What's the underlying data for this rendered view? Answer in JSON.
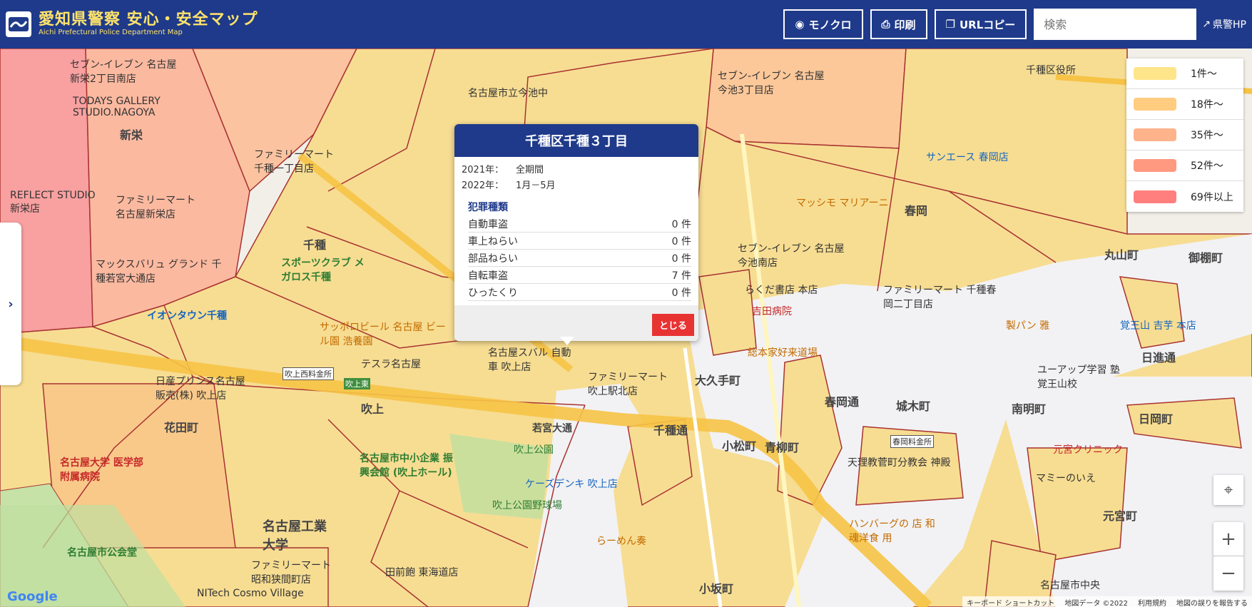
{
  "header": {
    "title": "愛知県警察 安心・安全マップ",
    "subtitle": "Aichi Prefectural Police Department Map",
    "buttons": {
      "mono": "モノクロ",
      "print": "印刷",
      "url_copy": "URLコピー"
    },
    "search_placeholder": "検索",
    "hp_link": "県警HP"
  },
  "legend": [
    {
      "label": "1件〜",
      "color": "#ffe58a"
    },
    {
      "label": "18件〜",
      "color": "#ffcc80"
    },
    {
      "label": "35件〜",
      "color": "#ffb38a"
    },
    {
      "label": "52件〜",
      "color": "#ff9980"
    },
    {
      "label": "69件以上",
      "color": "#ff7f7f"
    }
  ],
  "popup": {
    "title": "千種区千種３丁目",
    "period_2021_label": "2021年：",
    "period_2021_value": "全期間",
    "period_2022_label": "2022年：",
    "period_2022_value": "1月－5月",
    "crime_header": "犯罪種類",
    "crimes": [
      {
        "name": "自動車盗",
        "count": "0 件"
      },
      {
        "name": "車上ねらい",
        "count": "0 件"
      },
      {
        "name": "部品ねらい",
        "count": "0 件"
      },
      {
        "name": "自転車盗",
        "count": "7 件"
      },
      {
        "name": "ひったくり",
        "count": "0 件"
      }
    ],
    "close_label": "とじる"
  },
  "map_labels": {
    "shinsakae": "新栄",
    "chikusa": "千種",
    "fukiage": "吹上",
    "hanadacho": "花田町",
    "haruoka": "春岡",
    "ookute": "大久手町",
    "shirokicho": "城木町",
    "nanmeicho": "南明町",
    "chikusa_dori": "千種通",
    "komatsucho": "小松町",
    "aoyagicho": "青柳町",
    "haruoka_dori": "春岡通",
    "nisshin": "日進通",
    "maruyama": "丸山町",
    "gosho": "御棚町",
    "nittamachi": "日岡町",
    "motomiya": "元宮町",
    "kosaka": "小坂町",
    "nagoya_kodai": "名古屋工業大学",
    "seven_shinsakae": "セブン-イレブン 名古屋新栄2丁目南店",
    "todays_gallery": "TODAYS GALLERY STUDIO.NAGOYA",
    "reflect": "REFLECT STUDIO 新栄店",
    "family_shinsakae": "ファミリーマート 名古屋新栄店",
    "max_value": "マックスバリュ グランド 千種若宮大通店",
    "aeon": "イオンタウン千種",
    "sports_club": "スポーツクラブ メガロス千種",
    "sapporo": "サッポロビール 名古屋 ビール園 浩養園",
    "family_chikusa1": "ファミリーマート 千種一丁目店",
    "ikeshita_pond": "名古屋市立今池中",
    "seven_imaike3": "セブン-イレブン 名古屋今池3丁目店",
    "sun_ace": "サンエース 春岡店",
    "massimo": "マッシモ マリアーニ",
    "seven_imaikeminami": "セブン-イレブン 名古屋今池南店",
    "rakuda": "らくだ書店 本店",
    "yoshida": "吉田病院",
    "family_haruoka2": "ファミリーマート 千種春岡二丁目店",
    "chikusa_ward_office": "千種区役所",
    "subaru": "名古屋スバル 自動車 吹上店",
    "tesla": "テスラ名古屋",
    "family_fukiage": "ファミリーマート 吹上駅北店",
    "nissan_prince": "日産プリンス名古屋 販売(株) 吹上店",
    "fukiage_park": "吹上公園",
    "fukiage_hall": "名古屋市中小企業 振興会館 (吹上ホール)",
    "kesdenki": "ケーズデンキ 吹上店",
    "fukiage_ball": "吹上公園野球場",
    "nagoya_univ": "名古屋大学 医学部附属病院",
    "kokaido": "名古屋市公会堂",
    "family_showa": "ファミリーマート 昭和狭間町店",
    "denmae": "田前飽 東海道店",
    "nitech": "NITech Cosmo Village",
    "ramen": "らーめん奏",
    "hamburg": "ハンバーグの 店 和魂洋食 用",
    "tenri": "天理教菅町分教会 神殿",
    "sohonke": "総本家好来道場",
    "seipan": "製パン 雅",
    "kakuozan": "覚王山 吉芋 本店",
    "yuapp": "ユーアップ学習 塾 覚王山校",
    "motomiya_clinic": "元宮クリニック",
    "mamie": "マミーのいえ",
    "nagoya_chuo": "名古屋市中央",
    "toll_fukiage": "吹上西料金所",
    "toll_fukiage_e": "吹上東",
    "toll_haruoka": "春岡料金所",
    "wakamiya": "若宮大通"
  },
  "attribution": {
    "shortcuts": "キーボード ショートカット",
    "mapdata": "地図データ ©2022",
    "terms": "利用規約",
    "report": "地図の誤りを報告する"
  },
  "google_logo": "Google"
}
